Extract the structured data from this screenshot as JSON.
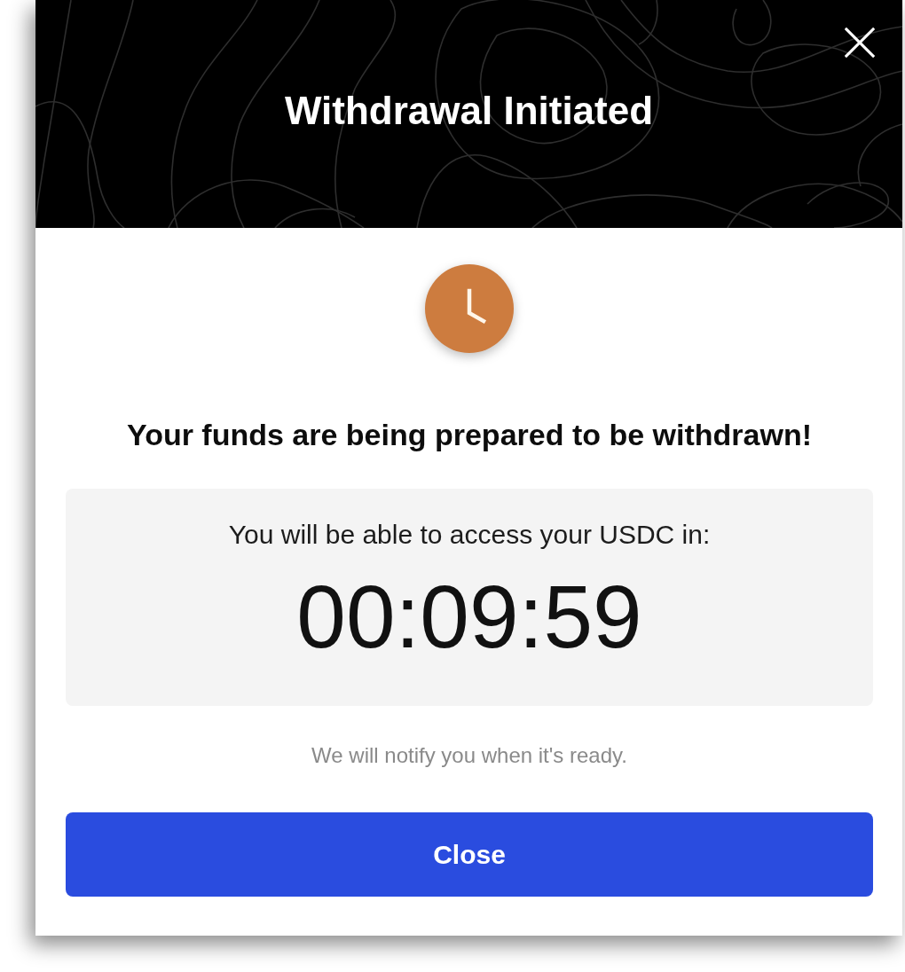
{
  "dialog": {
    "title": "Withdrawal Initiated"
  },
  "message": "Your funds are being prepared to be withdrawn!",
  "countdown": {
    "label": "You will be able to access your USDC in:",
    "time": "00:09:59"
  },
  "note": "We will notify you when it's ready.",
  "primary_button": {
    "label": "Close"
  }
}
